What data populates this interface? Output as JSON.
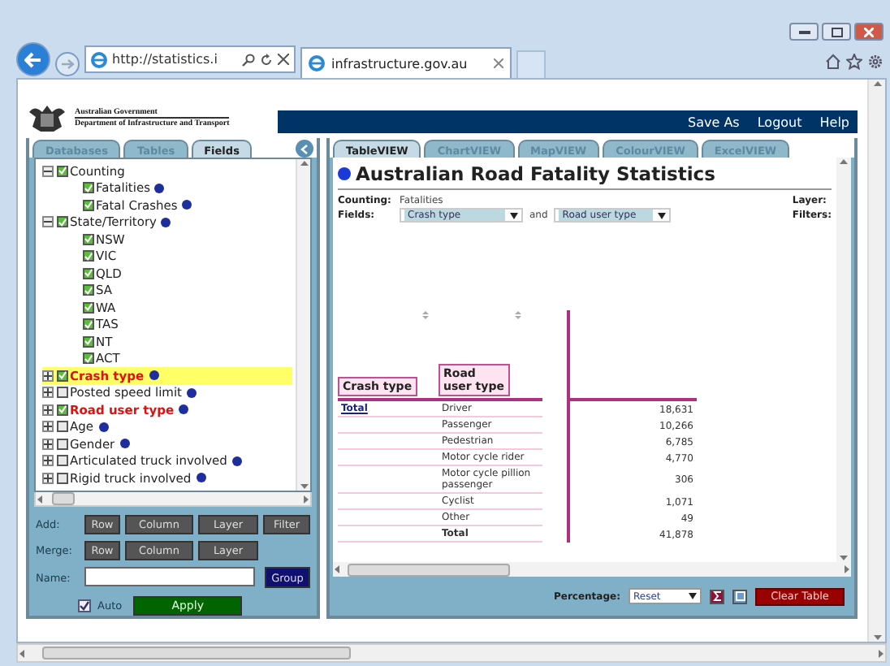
{
  "browser": {
    "address": "http://statistics.i",
    "tab_title": "infrastructure.gov.au"
  },
  "header": {
    "org_line1": "Australian Government",
    "org_line2": "Department of Infrastructure and Transport",
    "links": [
      "Save As",
      "Logout",
      "Help"
    ]
  },
  "left_tabs": [
    {
      "label": "Databases",
      "selected": false
    },
    {
      "label": "Tables",
      "selected": false
    },
    {
      "label": "Fields",
      "selected": true
    }
  ],
  "tree": [
    {
      "label": "Counting",
      "checked": true,
      "expanded": true,
      "info": false,
      "in_use": false,
      "selected": false,
      "children": [
        {
          "label": "Fatalities",
          "checked": true,
          "info": true,
          "in_use": false,
          "selected": false
        },
        {
          "label": "Fatal Crashes",
          "checked": true,
          "info": true,
          "in_use": false,
          "selected": false
        }
      ]
    },
    {
      "label": "State/Territory",
      "checked": true,
      "expanded": true,
      "info": true,
      "in_use": false,
      "selected": false,
      "children": [
        {
          "label": "NSW",
          "checked": true,
          "info": false,
          "in_use": false,
          "selected": false
        },
        {
          "label": "VIC",
          "checked": true,
          "info": false,
          "in_use": false,
          "selected": false
        },
        {
          "label": "QLD",
          "checked": true,
          "info": false,
          "in_use": false,
          "selected": false
        },
        {
          "label": "SA",
          "checked": true,
          "info": false,
          "in_use": false,
          "selected": false
        },
        {
          "label": "WA",
          "checked": true,
          "info": false,
          "in_use": false,
          "selected": false
        },
        {
          "label": "TAS",
          "checked": true,
          "info": false,
          "in_use": false,
          "selected": false
        },
        {
          "label": "NT",
          "checked": true,
          "info": false,
          "in_use": false,
          "selected": false
        },
        {
          "label": "ACT",
          "checked": true,
          "info": false,
          "in_use": false,
          "selected": false
        }
      ]
    },
    {
      "label": "Crash type",
      "checked": true,
      "expanded": false,
      "info": true,
      "in_use": true,
      "selected": true
    },
    {
      "label": "Posted speed limit",
      "checked": false,
      "expanded": false,
      "info": true,
      "in_use": false,
      "selected": false
    },
    {
      "label": "Road user type",
      "checked": true,
      "expanded": false,
      "info": true,
      "in_use": true,
      "selected": false
    },
    {
      "label": "Age",
      "checked": false,
      "expanded": false,
      "info": true,
      "in_use": false,
      "selected": false
    },
    {
      "label": "Gender",
      "checked": false,
      "expanded": false,
      "info": true,
      "in_use": false,
      "selected": false
    },
    {
      "label": "Articulated truck involved",
      "checked": false,
      "expanded": false,
      "info": true,
      "in_use": false,
      "selected": false
    },
    {
      "label": "Rigid truck involved",
      "checked": false,
      "expanded": false,
      "info": true,
      "in_use": false,
      "selected": false
    }
  ],
  "controls": {
    "add_label": "Add:",
    "add_buttons": [
      "Row",
      "Column",
      "Layer",
      "Filter"
    ],
    "merge_label": "Merge:",
    "merge_buttons": [
      "Row",
      "Column",
      "Layer"
    ],
    "name_label": "Name:",
    "group_button": "Group",
    "auto": {
      "label": "Auto",
      "checked": true
    },
    "apply_button": "Apply"
  },
  "right_tabs": [
    {
      "label": "TableVIEW",
      "selected": true
    },
    {
      "label": "ChartVIEW",
      "selected": false
    },
    {
      "label": "MapVIEW",
      "selected": false
    },
    {
      "label": "ColourVIEW",
      "selected": false
    },
    {
      "label": "ExcelVIEW",
      "selected": false
    }
  ],
  "title": "Australian Road Fatality Statistics",
  "summary": {
    "counting_label": "Counting:",
    "counting_value": "Fatalities",
    "fields_label": "Fields:",
    "field_1": "Crash type",
    "and_text": "and",
    "field_2": "Road user type",
    "layer_label": "Layer:",
    "filters_label": "Filters:"
  },
  "table": {
    "row_header": "Crash type",
    "column_header": "Road user type",
    "group_label": "Total",
    "rows": [
      {
        "label": "Driver",
        "value": "18,631",
        "kind": "item"
      },
      {
        "label": "Passenger",
        "value": "10,266",
        "kind": "item"
      },
      {
        "label": "Pedestrian",
        "value": "6,785",
        "kind": "item"
      },
      {
        "label": "Motor cycle rider",
        "value": "4,770",
        "kind": "item"
      },
      {
        "label": "Motor cycle pillion passenger",
        "value": "306",
        "kind": "item"
      },
      {
        "label": "Cyclist",
        "value": "1,071",
        "kind": "item"
      },
      {
        "label": "Other",
        "value": "49",
        "kind": "item"
      },
      {
        "label": "Total",
        "value": "41,878",
        "kind": "total"
      }
    ]
  },
  "footer": {
    "percentage_label": "Percentage:",
    "percentage_value": "Reset",
    "clear_button": "Clear Table"
  }
}
